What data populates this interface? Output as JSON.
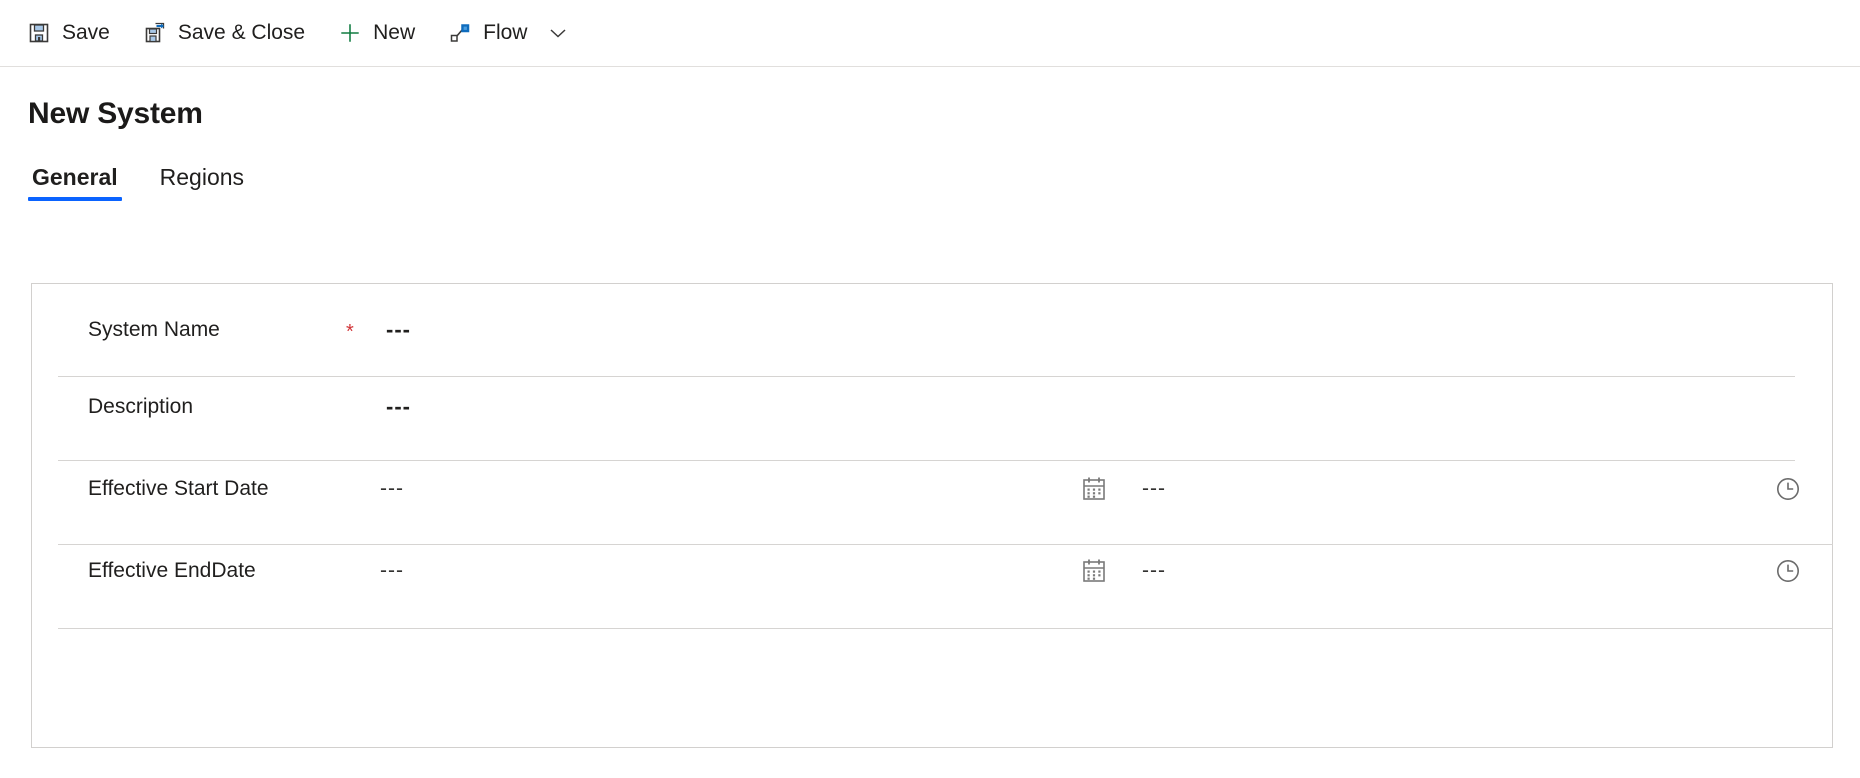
{
  "commandbar": {
    "items": [
      {
        "label": "Save",
        "icon": "save-icon"
      },
      {
        "label": "Save & Close",
        "icon": "save-and-close-icon"
      },
      {
        "label": "New",
        "icon": "plus-icon"
      },
      {
        "label": "Flow",
        "icon": "flow-icon"
      }
    ],
    "overflow_icon": "chevron-down-icon"
  },
  "page": {
    "title": "New System"
  },
  "tabs": [
    {
      "label": "General",
      "active": true
    },
    {
      "label": "Regions",
      "active": false
    }
  ],
  "form": {
    "rows": [
      {
        "label": "System Name",
        "required": "*",
        "value": "---",
        "type": "text"
      },
      {
        "label": "Description",
        "required": "",
        "value": "---",
        "type": "text"
      },
      {
        "label": "Effective Start Date",
        "required": "",
        "date_value": "---",
        "time_value": "---",
        "date_icon": "calendar-icon",
        "time_icon": "clock-icon",
        "type": "datetime"
      },
      {
        "label": "Effective EndDate",
        "required": "",
        "date_value": "---",
        "time_value": "---",
        "date_icon": "calendar-icon",
        "time_icon": "clock-icon",
        "type": "datetime"
      }
    ]
  },
  "colors": {
    "accent": "#0a63ff",
    "required": "#d13438",
    "icon_blue": "#0f6cbd",
    "icon_green": "#107c41",
    "icon_gray": "#595959",
    "border": "#d2d0ce"
  }
}
